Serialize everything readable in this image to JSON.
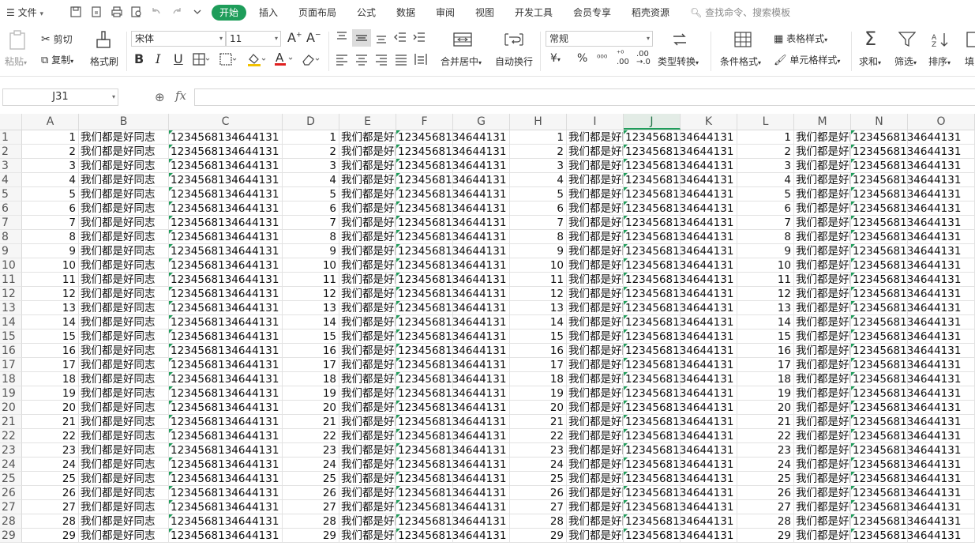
{
  "menubar": {
    "file_label": "文件",
    "tabs": [
      {
        "label": "开始",
        "active": true
      },
      {
        "label": "插入"
      },
      {
        "label": "页面布局"
      },
      {
        "label": "公式"
      },
      {
        "label": "数据"
      },
      {
        "label": "审阅"
      },
      {
        "label": "视图"
      },
      {
        "label": "开发工具"
      },
      {
        "label": "会员专享"
      },
      {
        "label": "稻壳资源"
      }
    ],
    "search_placeholder": "查找命令、搜索模板"
  },
  "ribbon": {
    "paste": "粘贴",
    "cut": "剪切",
    "copy": "复制",
    "format_painter": "格式刷",
    "font_name": "宋体",
    "font_size": "11",
    "merge_center": "合并居中",
    "wrap_text": "自动换行",
    "number_format": "常规",
    "type_convert": "类型转换",
    "cond_format": "条件格式",
    "table_style": "表格样式",
    "cell_style": "单元格样式",
    "sum": "求和",
    "filter": "筛选",
    "sort": "排序",
    "fill": "填"
  },
  "formula_bar": {
    "cell_ref": "J31",
    "fx_label": "fx",
    "value": ""
  },
  "colors": {
    "accent": "#1e9d5a",
    "header_bg": "#f6f6f6",
    "grid_line": "#e2e2e2"
  },
  "sheet": {
    "columns": [
      "A",
      "B",
      "C",
      "D",
      "E",
      "F",
      "G",
      "H",
      "I",
      "J",
      "K",
      "L",
      "M",
      "N",
      "O"
    ],
    "active_column": "J",
    "row_text": "我们都是好同志",
    "row_number_string": "123456813464413​1",
    "row_count": 29
  }
}
